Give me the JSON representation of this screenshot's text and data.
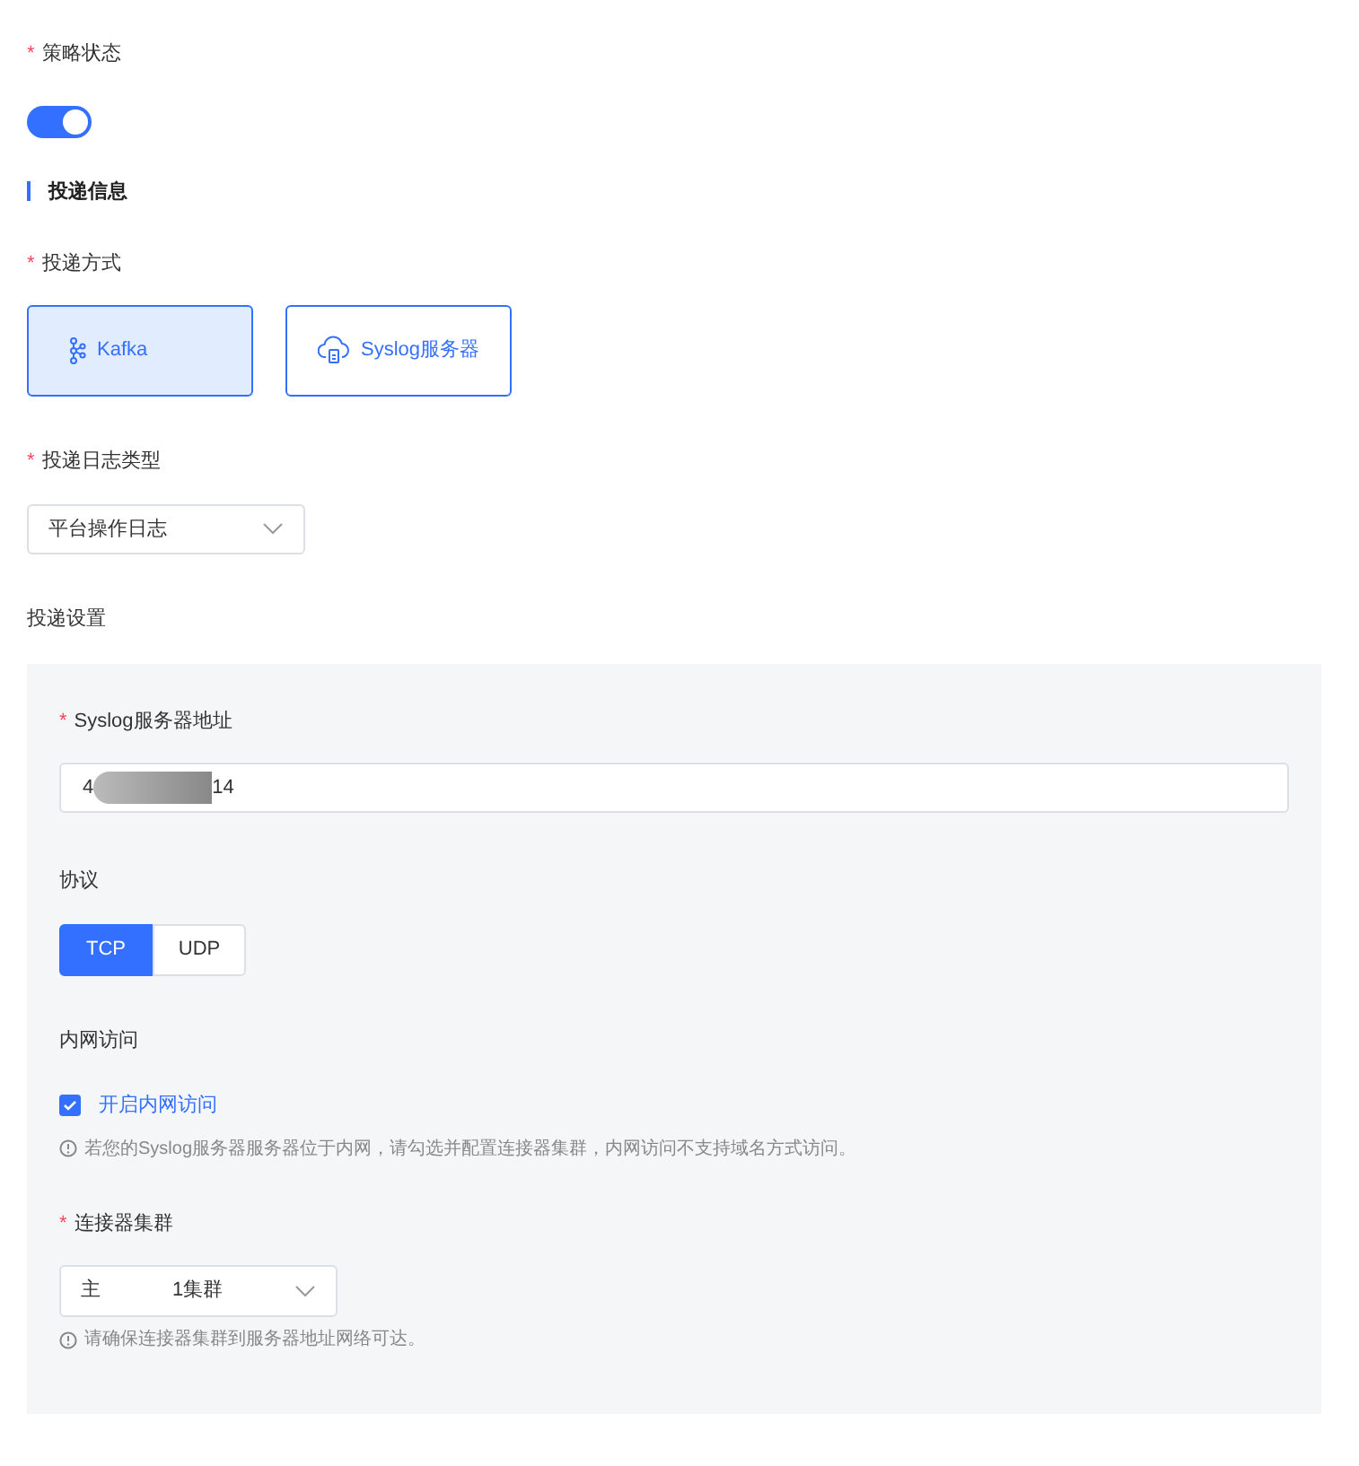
{
  "policy_status": {
    "label": "策略状态",
    "required": "*",
    "on": true
  },
  "section": {
    "title": "投递信息"
  },
  "delivery_method": {
    "label": "投递方式",
    "required": "*",
    "options": [
      {
        "kind": "kafka",
        "label": "Kafka",
        "selected": true
      },
      {
        "kind": "syslog",
        "label": "Syslog服务器",
        "selected": false
      }
    ]
  },
  "log_type": {
    "label": "投递日志类型",
    "required": "*",
    "value": "平台操作日志"
  },
  "settings": {
    "title": "投递设置",
    "server_address": {
      "label": "Syslog服务器地址",
      "required": "*",
      "value_start": "4",
      "value_end": "14"
    },
    "protocol": {
      "label": "协议",
      "options": [
        {
          "label": "TCP",
          "selected": true
        },
        {
          "label": "UDP",
          "selected": false
        }
      ]
    },
    "intranet": {
      "label": "内网访问",
      "checkbox": {
        "label": "开启内网访问",
        "checked": true
      },
      "hint": "若您的Syslog服务器服务器位于内网，请勾选并配置连接器集群，内网访问不支持域名方式访问。"
    },
    "connector_cluster": {
      "label": "连接器集群",
      "required": "*",
      "value_start": "主",
      "value_end": "1集群",
      "hint": "请确保连接器集群到服务器地址网络可达。"
    }
  }
}
